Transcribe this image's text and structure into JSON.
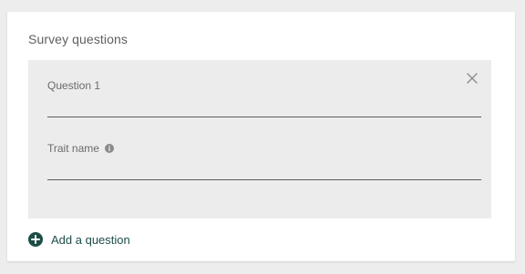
{
  "survey": {
    "title": "Survey questions",
    "questions": [
      {
        "question_label": "Question 1",
        "question_value": "",
        "trait_label": "Trait name",
        "trait_value": ""
      }
    ],
    "add_question_label": "Add a question"
  },
  "icons": {
    "close": "close-icon",
    "info": "info-icon",
    "add": "plus-circle-icon"
  },
  "colors": {
    "accent": "#1c4d47",
    "block_background": "#ececec",
    "page_background": "#ededed",
    "card_background": "#ffffff"
  }
}
